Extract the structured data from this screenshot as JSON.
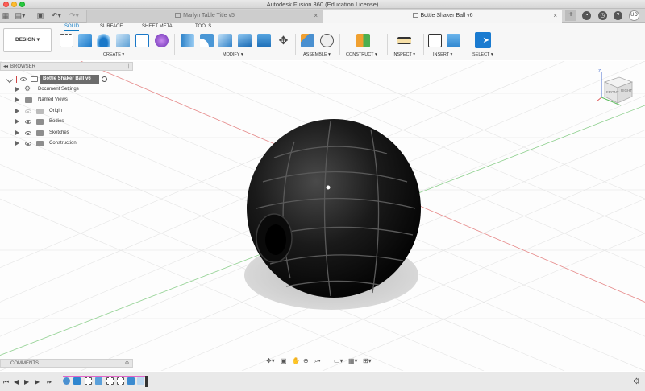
{
  "window": {
    "title": "Autodesk Fusion 360 (Education License)"
  },
  "tabs": {
    "inactive_title": "Marlyn Table Title v5",
    "active_title": "Bottle Shaker Ball v6",
    "close_glyph": "×",
    "add_glyph": "+",
    "user_initials": "UD"
  },
  "toolbar": {
    "workspace": "DESIGN ▾",
    "top_tabs": [
      "SOLID",
      "SURFACE",
      "SHEET METAL",
      "TOOLS"
    ],
    "groups": [
      "CREATE ▾",
      "MODIFY ▾",
      "ASSEMBLE ▾",
      "CONSTRUCT ▾",
      "INSPECT ▾",
      "INSERT ▾",
      "SELECT ▾"
    ]
  },
  "browser": {
    "header": "BROWSER",
    "items": [
      {
        "label": "Bottle Shaker Ball v6"
      },
      {
        "label": "Document Settings"
      },
      {
        "label": "Named Views"
      },
      {
        "label": "Origin"
      },
      {
        "label": "Bodies"
      },
      {
        "label": "Sketches"
      },
      {
        "label": "Construction"
      }
    ]
  },
  "comments": {
    "header": "COMMENTS"
  },
  "viewcube": {
    "front": "FRONT",
    "right": "RIGHT",
    "axis_x": "X",
    "axis_y": "Y",
    "axis_z": "Z"
  },
  "colors": {
    "accent": "#0a77c2",
    "sketch_line": "#e06060",
    "timeline": "#e066c7"
  }
}
